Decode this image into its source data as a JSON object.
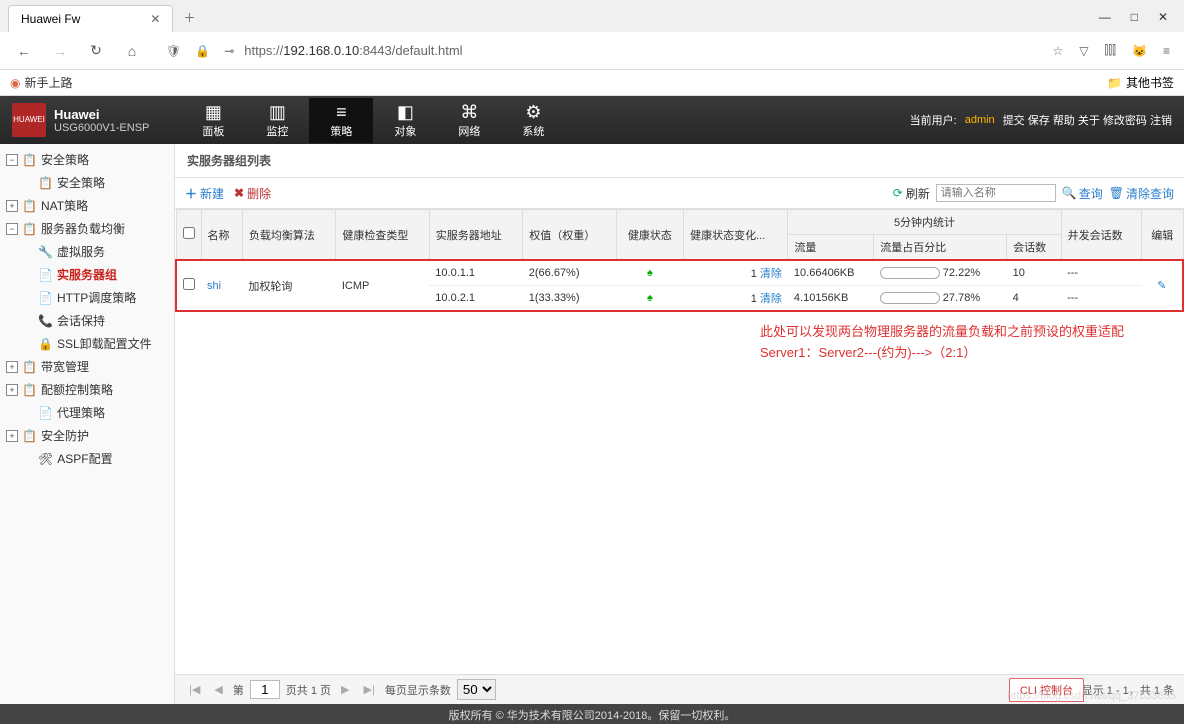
{
  "browser": {
    "tab_title": "Huawei Fw",
    "url_prefix": "https://",
    "url_host": "192.168.0.10",
    "url_path": ":8443/default.html",
    "bookmark_newbie": "新手上路",
    "other_bookmarks": "其他书签"
  },
  "header": {
    "brand": "Huawei",
    "model": "USG6000V1-ENSP",
    "logo_text": "HUAWEI",
    "tabs": [
      {
        "icon": "▦",
        "label": "面板"
      },
      {
        "icon": "▥",
        "label": "监控"
      },
      {
        "icon": "≡",
        "label": "策略"
      },
      {
        "icon": "◧",
        "label": "对象"
      },
      {
        "icon": "⌘",
        "label": "网络"
      },
      {
        "icon": "⚙",
        "label": "系统"
      }
    ],
    "active_tab": 2,
    "current_user_label": "当前用户:",
    "current_user": "admin",
    "links": [
      "提交",
      "保存",
      "帮助",
      "关于",
      "修改密码",
      "注销"
    ]
  },
  "sidebar": [
    {
      "type": "expand",
      "state": "−",
      "label": "安全策略",
      "level": 0
    },
    {
      "type": "leaf",
      "label": "安全策略",
      "level": 2
    },
    {
      "type": "expand",
      "state": "+",
      "label": "NAT策略",
      "level": 0
    },
    {
      "type": "expand",
      "state": "−",
      "label": "服务器负载均衡",
      "level": 0
    },
    {
      "type": "leaf",
      "label": "虚拟服务",
      "level": 2,
      "icon": "🔧"
    },
    {
      "type": "leaf",
      "label": "实服务器组",
      "level": 2,
      "icon": "📄",
      "selected": true
    },
    {
      "type": "leaf",
      "label": "HTTP调度策略",
      "level": 2,
      "icon": "📄"
    },
    {
      "type": "leaf",
      "label": "会话保持",
      "level": 2,
      "icon": "📞"
    },
    {
      "type": "leaf",
      "label": "SSL卸载配置文件",
      "level": 2,
      "icon": "🔒"
    },
    {
      "type": "expand",
      "state": "+",
      "label": "带宽管理",
      "level": 0
    },
    {
      "type": "expand",
      "state": "+",
      "label": "配额控制策略",
      "level": 0
    },
    {
      "type": "leaf",
      "label": "代理策略",
      "level": 1,
      "icon": "📄"
    },
    {
      "type": "expand",
      "state": "+",
      "label": "安全防护",
      "level": 0
    },
    {
      "type": "leaf",
      "label": "ASPF配置",
      "level": 1,
      "icon": "🛠"
    }
  ],
  "content": {
    "title": "实服务器组列表",
    "toolbar": {
      "new": "新建",
      "delete": "删除",
      "refresh": "刷新",
      "search_placeholder": "请输入名称",
      "query": "查询",
      "clear_query": "清除查询"
    },
    "columns": {
      "name": "名称",
      "algorithm": "负载均衡算法",
      "health_type": "健康检查类型",
      "server_addr": "实服务器地址",
      "weight": "权值（权重）",
      "health_status": "健康状态",
      "health_change": "健康状态变化...",
      "stats_group": "5分钟内统计",
      "traffic": "流量",
      "traffic_pct": "流量占百分比",
      "sessions": "会话数",
      "concurrent": "并发会话数",
      "edit": "编辑"
    },
    "row": {
      "name": "shi",
      "algorithm": "加权轮询",
      "health_type": "ICMP",
      "servers": [
        {
          "addr": "10.0.1.1",
          "weight": "2(66.67%)",
          "status": "↑",
          "change": "1",
          "clear": "清除",
          "traffic": "10.66406KB",
          "pct": 72.22,
          "pct_txt": "72.22%",
          "sessions": "10",
          "concurrent": "---"
        },
        {
          "addr": "10.0.2.1",
          "weight": "1(33.33%)",
          "status": "↑",
          "change": "1",
          "clear": "清除",
          "traffic": "4.10156KB",
          "pct": 27.78,
          "pct_txt": "27.78%",
          "sessions": "4",
          "concurrent": "---"
        }
      ]
    },
    "annotation_l1": "此处可以发现两台物理服务器的流量负载和之前预设的权重适配",
    "annotation_l2": "Server1：Server2---(约为)--->（2:1）"
  },
  "pager": {
    "page_label_pre": "第",
    "page_value": "1",
    "page_label_post": "页共 1 页",
    "per_page_label": "每页显示条数",
    "per_page_value": "50",
    "summary": "显示 1 - 1，共 1 条"
  },
  "footer": {
    "cli": "CLI 控制台",
    "copyright": "版权所有 © 华为技术有限公司2014-2018。保留一切权利。",
    "watermark": "https://blog.csdn.net/qq_37633855"
  }
}
